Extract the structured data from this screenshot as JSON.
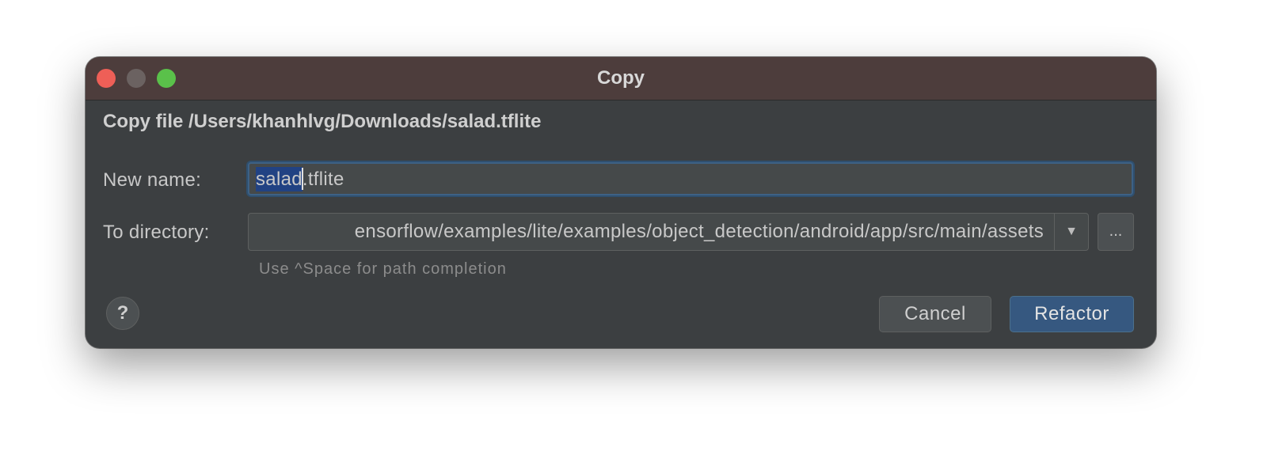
{
  "window": {
    "title": "Copy"
  },
  "dialog": {
    "heading": "Copy file /Users/khanhlvg/Downloads/salad.tflite",
    "new_name_label": "New name:",
    "new_name_selected": "salad",
    "new_name_rest": ".tflite",
    "to_directory_label": "To directory:",
    "to_directory_value": "ensorflow/examples/lite/examples/object_detection/android/app/src/main/assets",
    "dropdown_icon": "chevron-down-icon",
    "browse_label": "...",
    "hint": "Use ^Space for path completion",
    "help_label": "?",
    "cancel_label": "Cancel",
    "refactor_label": "Refactor"
  },
  "colors": {
    "titlebar": "#4d3d3c",
    "body": "#3c3f41",
    "accent": "#365880",
    "selection": "#214283",
    "close": "#ee5f57",
    "zoom": "#5ac14a"
  }
}
